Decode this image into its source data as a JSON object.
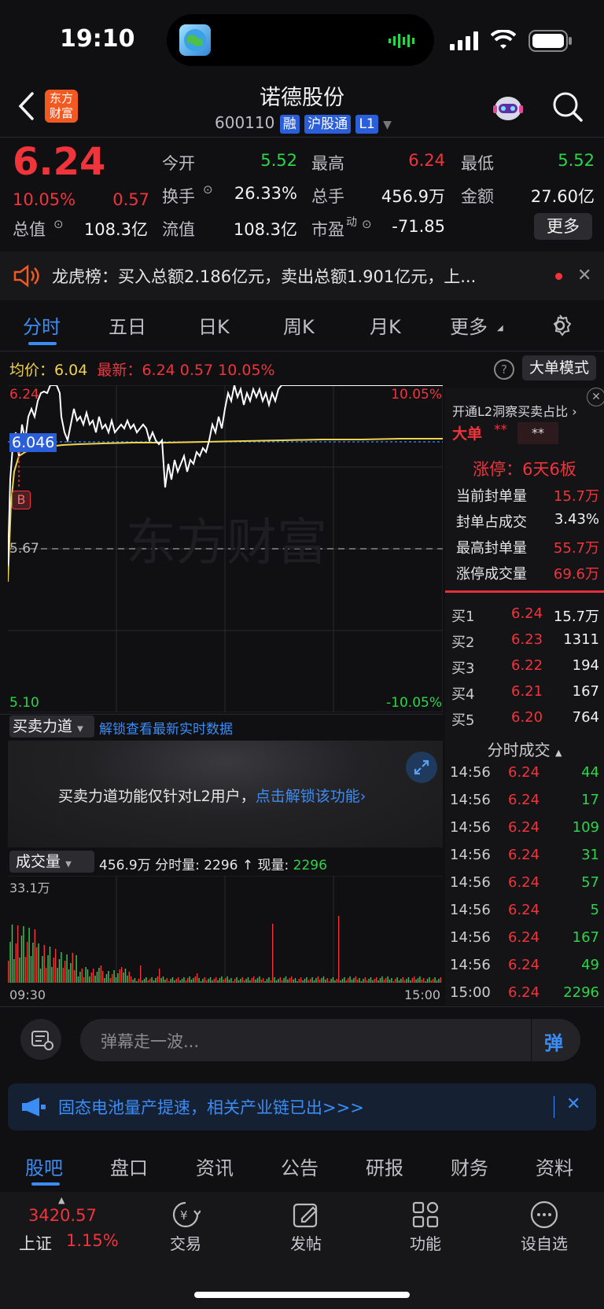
{
  "status_bar": {
    "time": "19:10"
  },
  "header": {
    "logo_text": "东方财富",
    "title": "诺德股份",
    "code": "600110",
    "badges": [
      "融",
      "沪股通",
      "L1"
    ]
  },
  "quote": {
    "price": "6.24",
    "change_pct": "10.05%",
    "change": "0.57",
    "rows": [
      [
        {
          "label": "今开",
          "value": "5.52",
          "color": "green"
        },
        {
          "label": "最高",
          "value": "6.24",
          "color": "red"
        },
        {
          "label": "最低",
          "value": "5.52",
          "color": "green"
        }
      ],
      [
        {
          "label": "换手",
          "value": "26.33%",
          "color": "white"
        },
        {
          "label": "总手",
          "value": "456.9万",
          "color": "white"
        },
        {
          "label": "金额",
          "value": "27.60亿",
          "color": "white"
        }
      ],
      [
        {
          "label": "总值",
          "value": "108.3亿",
          "color": "white"
        },
        {
          "label": "流值",
          "value": "108.3亿",
          "color": "white"
        },
        {
          "label": "市盈",
          "value": "-71.85",
          "color": "white"
        }
      ]
    ],
    "pe_sup": "动",
    "more_button": "更多"
  },
  "notice": {
    "text": "龙虎榜：买入总额2.186亿元，卖出总额1.901亿元，上..."
  },
  "chart_tabs": [
    "分时",
    "五日",
    "日K",
    "周K",
    "月K",
    "更多"
  ],
  "avg_line": {
    "avg_label": "均价：",
    "avg": "6.04",
    "latest_label": "最新：",
    "latest": "6.24",
    "change": "0.57",
    "pct": "10.05%",
    "big_order_button": "大单模式"
  },
  "chart_labels": {
    "top_price": "6.24",
    "top_pct": "10.05%",
    "cursor_price": "6.046",
    "mid_price": "5.67",
    "bottom_price": "5.10",
    "bottom_pct": "-10.05%",
    "watermark": "东方财富",
    "buy_marker": "B"
  },
  "side_panel": {
    "l2_promo": "开通L2洞察买卖占比",
    "big_order_label": "大单",
    "big_order_value": "**",
    "big_order_value2": "**",
    "limit_up_title": "涨停：6天6板",
    "stats": [
      {
        "label": "当前封单量",
        "value": "15.7万",
        "color": "red"
      },
      {
        "label": "封单占成交",
        "value": "3.43%",
        "color": "white"
      },
      {
        "label": "最高封单量",
        "value": "55.7万",
        "color": "red"
      },
      {
        "label": "涨停成交量",
        "value": "69.6万",
        "color": "red"
      }
    ],
    "bids": [
      {
        "label": "买1",
        "price": "6.24",
        "vol": "15.7万"
      },
      {
        "label": "买2",
        "price": "6.23",
        "vol": "1311"
      },
      {
        "label": "买3",
        "price": "6.22",
        "vol": "194"
      },
      {
        "label": "买4",
        "price": "6.21",
        "vol": "167"
      },
      {
        "label": "买5",
        "price": "6.20",
        "vol": "764"
      }
    ],
    "trades_title": "分时成交",
    "trades": [
      {
        "time": "14:56",
        "price": "6.24",
        "vol": "44"
      },
      {
        "time": "14:56",
        "price": "6.24",
        "vol": "17"
      },
      {
        "time": "14:56",
        "price": "6.24",
        "vol": "109"
      },
      {
        "time": "14:56",
        "price": "6.24",
        "vol": "31"
      },
      {
        "time": "14:56",
        "price": "6.24",
        "vol": "57"
      },
      {
        "time": "14:56",
        "price": "6.24",
        "vol": "5"
      },
      {
        "time": "14:56",
        "price": "6.24",
        "vol": "167"
      },
      {
        "time": "14:56",
        "price": "6.24",
        "vol": "49"
      },
      {
        "time": "15:00",
        "price": "6.24",
        "vol": "2296"
      }
    ]
  },
  "force_panel": {
    "dropdown": "买卖力道",
    "hint": "解锁查看最新实时数据",
    "message": "买卖力道功能仅针对L2用户，",
    "unlock_link": "点击解锁该功能"
  },
  "volume_panel": {
    "dropdown": "成交量",
    "summary": "456.9万 分时量: 2296 ↑ 现量: ",
    "current": "2296",
    "max_label": "33.1万",
    "start_time": "09:30",
    "end_time": "15:00"
  },
  "comment_bar": {
    "placeholder": "弹幕走一波...",
    "send_icon_text": "弹"
  },
  "ad_banner": {
    "text": "固态电池量产提速，相关产业链已出>>>"
  },
  "bottom_tabs": [
    "股吧",
    "盘口",
    "资讯",
    "公告",
    "研报",
    "财务",
    "资料"
  ],
  "bottom_nav": {
    "index_value": "3420.57",
    "index_name": "上证",
    "index_pct": "1.15%",
    "items": [
      "交易",
      "发帖",
      "功能",
      "设自选"
    ]
  },
  "colors": {
    "up": "#f0343b",
    "down": "#2dd44a",
    "accent": "#3b8cf5",
    "price_line": "#ffffff",
    "avg_line": "#f1d34a"
  }
}
